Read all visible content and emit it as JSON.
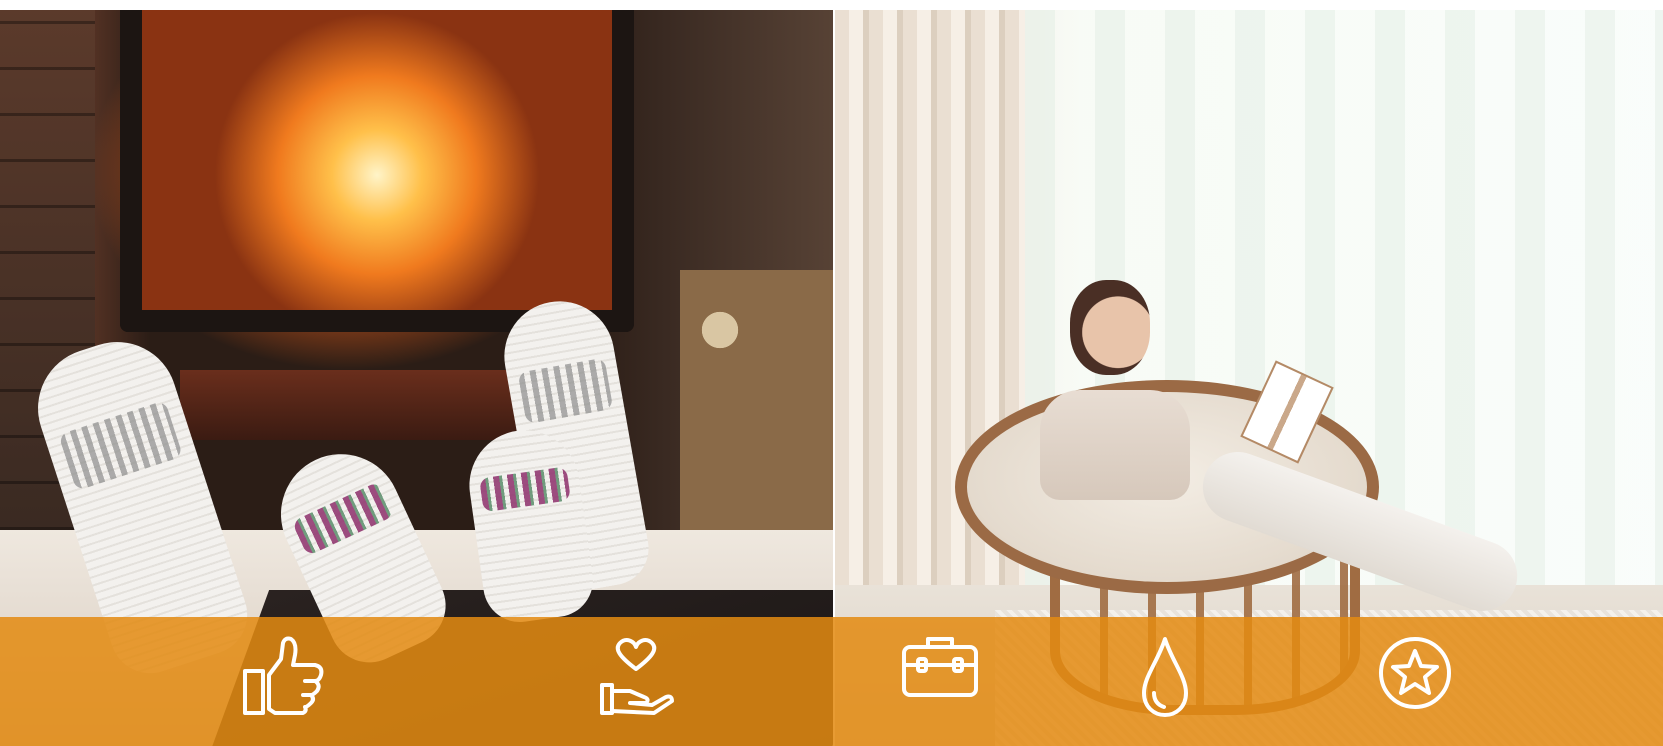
{
  "colors": {
    "icon_bar": "#e38a12",
    "icon_stroke": "#ffffff"
  },
  "panels": {
    "left_image": "fireplace-socks-photo",
    "right_image": "woman-reading-papasan-chair-photo"
  },
  "icon_bar": {
    "icons": [
      {
        "name": "thumbs-up-icon"
      },
      {
        "name": "heart-in-hand-icon"
      },
      {
        "name": "briefcase-icon"
      },
      {
        "name": "water-drop-icon"
      },
      {
        "name": "star-in-circle-icon"
      }
    ]
  }
}
